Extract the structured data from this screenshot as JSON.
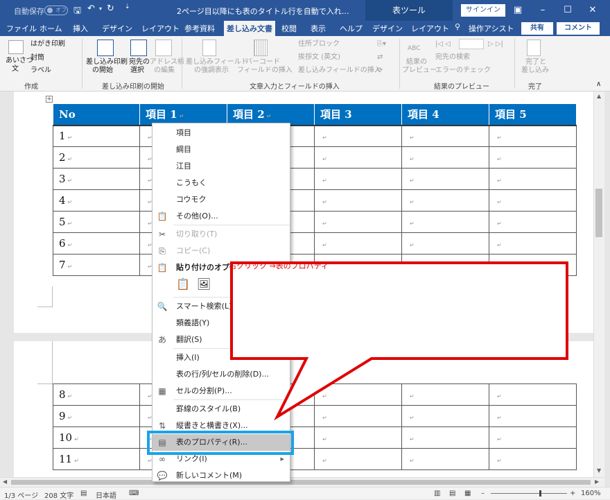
{
  "titlebar": {
    "autosave": "自動保存",
    "autosave_state": "オフ",
    "doc_title": "2ページ目以降にも表のタイトル行を自動で入れ…",
    "context_tools": "表ツール",
    "signin": "サインイン"
  },
  "tabs": [
    {
      "label": "ファイル"
    },
    {
      "label": "ホーム"
    },
    {
      "label": "挿入"
    },
    {
      "label": "デザイン"
    },
    {
      "label": "レイアウト"
    },
    {
      "label": "参考資料"
    },
    {
      "label": "差し込み文書"
    },
    {
      "label": "校閲"
    },
    {
      "label": "表示"
    },
    {
      "label": "ヘルプ"
    },
    {
      "label": "デザイン"
    },
    {
      "label": "レイアウト"
    },
    {
      "label": "操作アシスト"
    }
  ],
  "share": "共有",
  "comment": "コメント",
  "ribbon": {
    "create": {
      "hagaki": "はがき印刷",
      "futo": "封筒",
      "label": "ラベル",
      "aisatsu": "あいさつ",
      "aisatsu2": "文",
      "group": "作成"
    },
    "start": {
      "b1a": "差し込み印刷",
      "b1b": "の開始",
      "b2a": "宛先の",
      "b2b": "選択",
      "b3a": "アドレス帳",
      "b3b": "の編集",
      "group": "差し込み印刷の開始"
    },
    "fields": {
      "b1a": "差し込みフィールド",
      "b1b": "の強調表示",
      "b2a": "バーコード",
      "b2b": "フィールドの挿入",
      "addr": "住所ブロック",
      "greet": "挨拶文 (英文)",
      "insert": "差し込みフィールドの挿入",
      "group": "文章入力とフィールドの挿入"
    },
    "preview": {
      "abc": "ABC",
      "b1a": "結果の",
      "b1b": "プレビュー",
      "find": "宛先の検索",
      "err": "エラーのチェック",
      "group": "結果のプレビュー"
    },
    "finish": {
      "b1a": "完了と",
      "b1b": "差し込み",
      "group": "完了"
    }
  },
  "table": {
    "headers": [
      "No",
      "項目 1",
      "項目 2",
      "項目 3",
      "項目 4",
      "項目 5"
    ],
    "rows_top": [
      "1",
      "2",
      "3",
      "4",
      "5",
      "6",
      "7"
    ],
    "rows_bottom": [
      "8",
      "9",
      "10",
      "11"
    ]
  },
  "context_menu": {
    "items": [
      {
        "label": "項目"
      },
      {
        "label": "綱目"
      },
      {
        "label": "江目"
      },
      {
        "label": "こうもく"
      },
      {
        "label": "コウモク"
      },
      {
        "label": "その他(O)..."
      },
      {
        "label": "切り取り(T)"
      },
      {
        "label": "コピー(C)"
      },
      {
        "label": "貼り付けのオプション:"
      },
      {
        "label": "スマート検索(L)"
      },
      {
        "label": "類義語(Y)"
      },
      {
        "label": "翻訳(S)"
      },
      {
        "label": "挿入(I)"
      },
      {
        "label": "表の行/列/セルの削除(D)..."
      },
      {
        "label": "セルの分割(P)..."
      },
      {
        "label": "罫線のスタイル(B)"
      },
      {
        "label": "縦書きと横書き(X)..."
      },
      {
        "label": "表のプロパティ(R)..."
      },
      {
        "label": "リンク(I)"
      },
      {
        "label": "新しいコメント(M)"
      }
    ]
  },
  "callout": {
    "line1": "右クリック",
    "line2": "⇒表のプロパティ"
  },
  "status": {
    "page": "1/3 ページ",
    "words": "208 文字",
    "lang": "日本語",
    "zoom": "160%"
  },
  "colors": {
    "word_blue": "#2b579a",
    "table_header": "#0070c0",
    "callout_red": "#e00000",
    "highlight": "#1aa3e8"
  }
}
